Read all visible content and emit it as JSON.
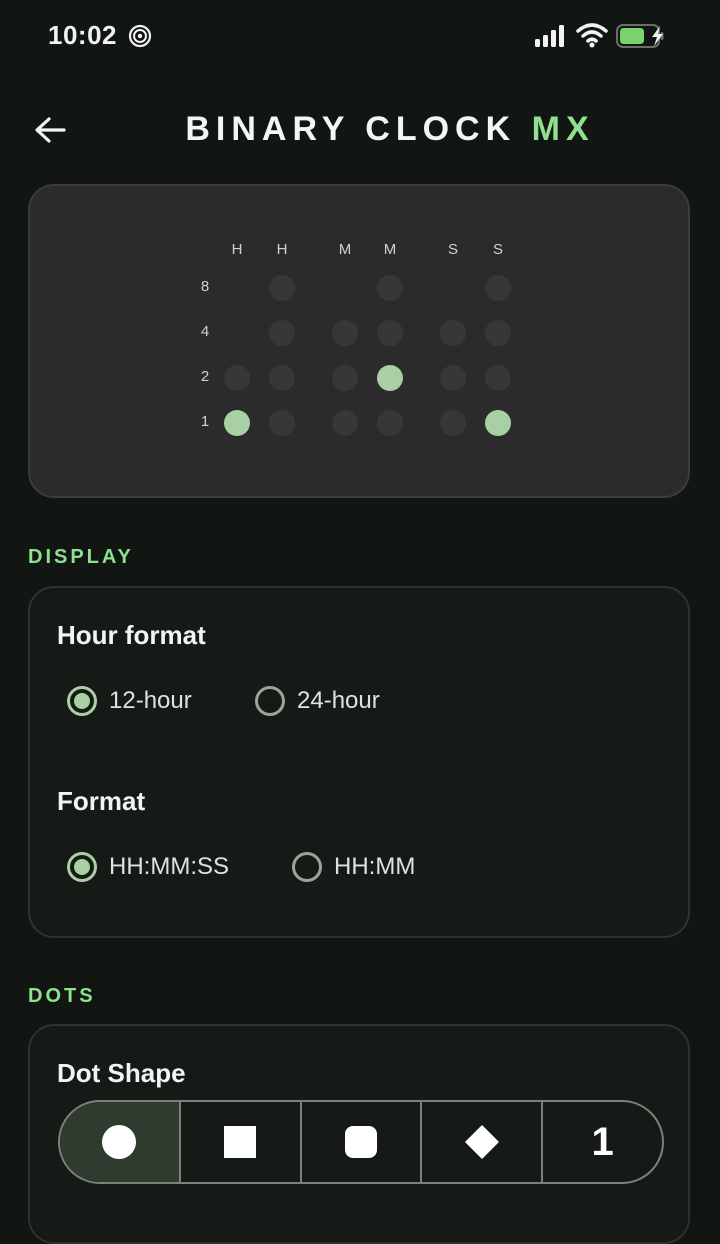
{
  "status_bar": {
    "time": "10:02"
  },
  "header": {
    "title_main": "BINARY CLOCK",
    "title_accent": "MX"
  },
  "preview": {
    "column_labels": [
      "H",
      "H",
      "M",
      "M",
      "S",
      "S"
    ],
    "row_labels": [
      "8",
      "4",
      "2",
      "1"
    ],
    "bits_on": {
      "H1": [
        1
      ],
      "H2": [],
      "M1": [],
      "M2": [
        2
      ],
      "S1": [],
      "S2": [
        1
      ]
    }
  },
  "display": {
    "section_title": "DISPLAY",
    "hour_format": {
      "heading": "Hour format",
      "options": [
        "12-hour",
        "24-hour"
      ],
      "selected": "12-hour"
    },
    "format": {
      "heading": "Format",
      "options": [
        "HH:MM:SS",
        "HH:MM"
      ],
      "selected": "HH:MM:SS"
    }
  },
  "dots": {
    "section_title": "DOTS",
    "dot_shape": {
      "heading": "Dot Shape",
      "options": [
        "circle-icon",
        "square-icon",
        "rounded-square-icon",
        "diamond-icon",
        "1"
      ],
      "selected": "circle-icon"
    }
  },
  "colors": {
    "accent": "#8fe08f",
    "dot_on": "#a8d0a4",
    "dot_off": "#363836",
    "background": "#121612"
  }
}
